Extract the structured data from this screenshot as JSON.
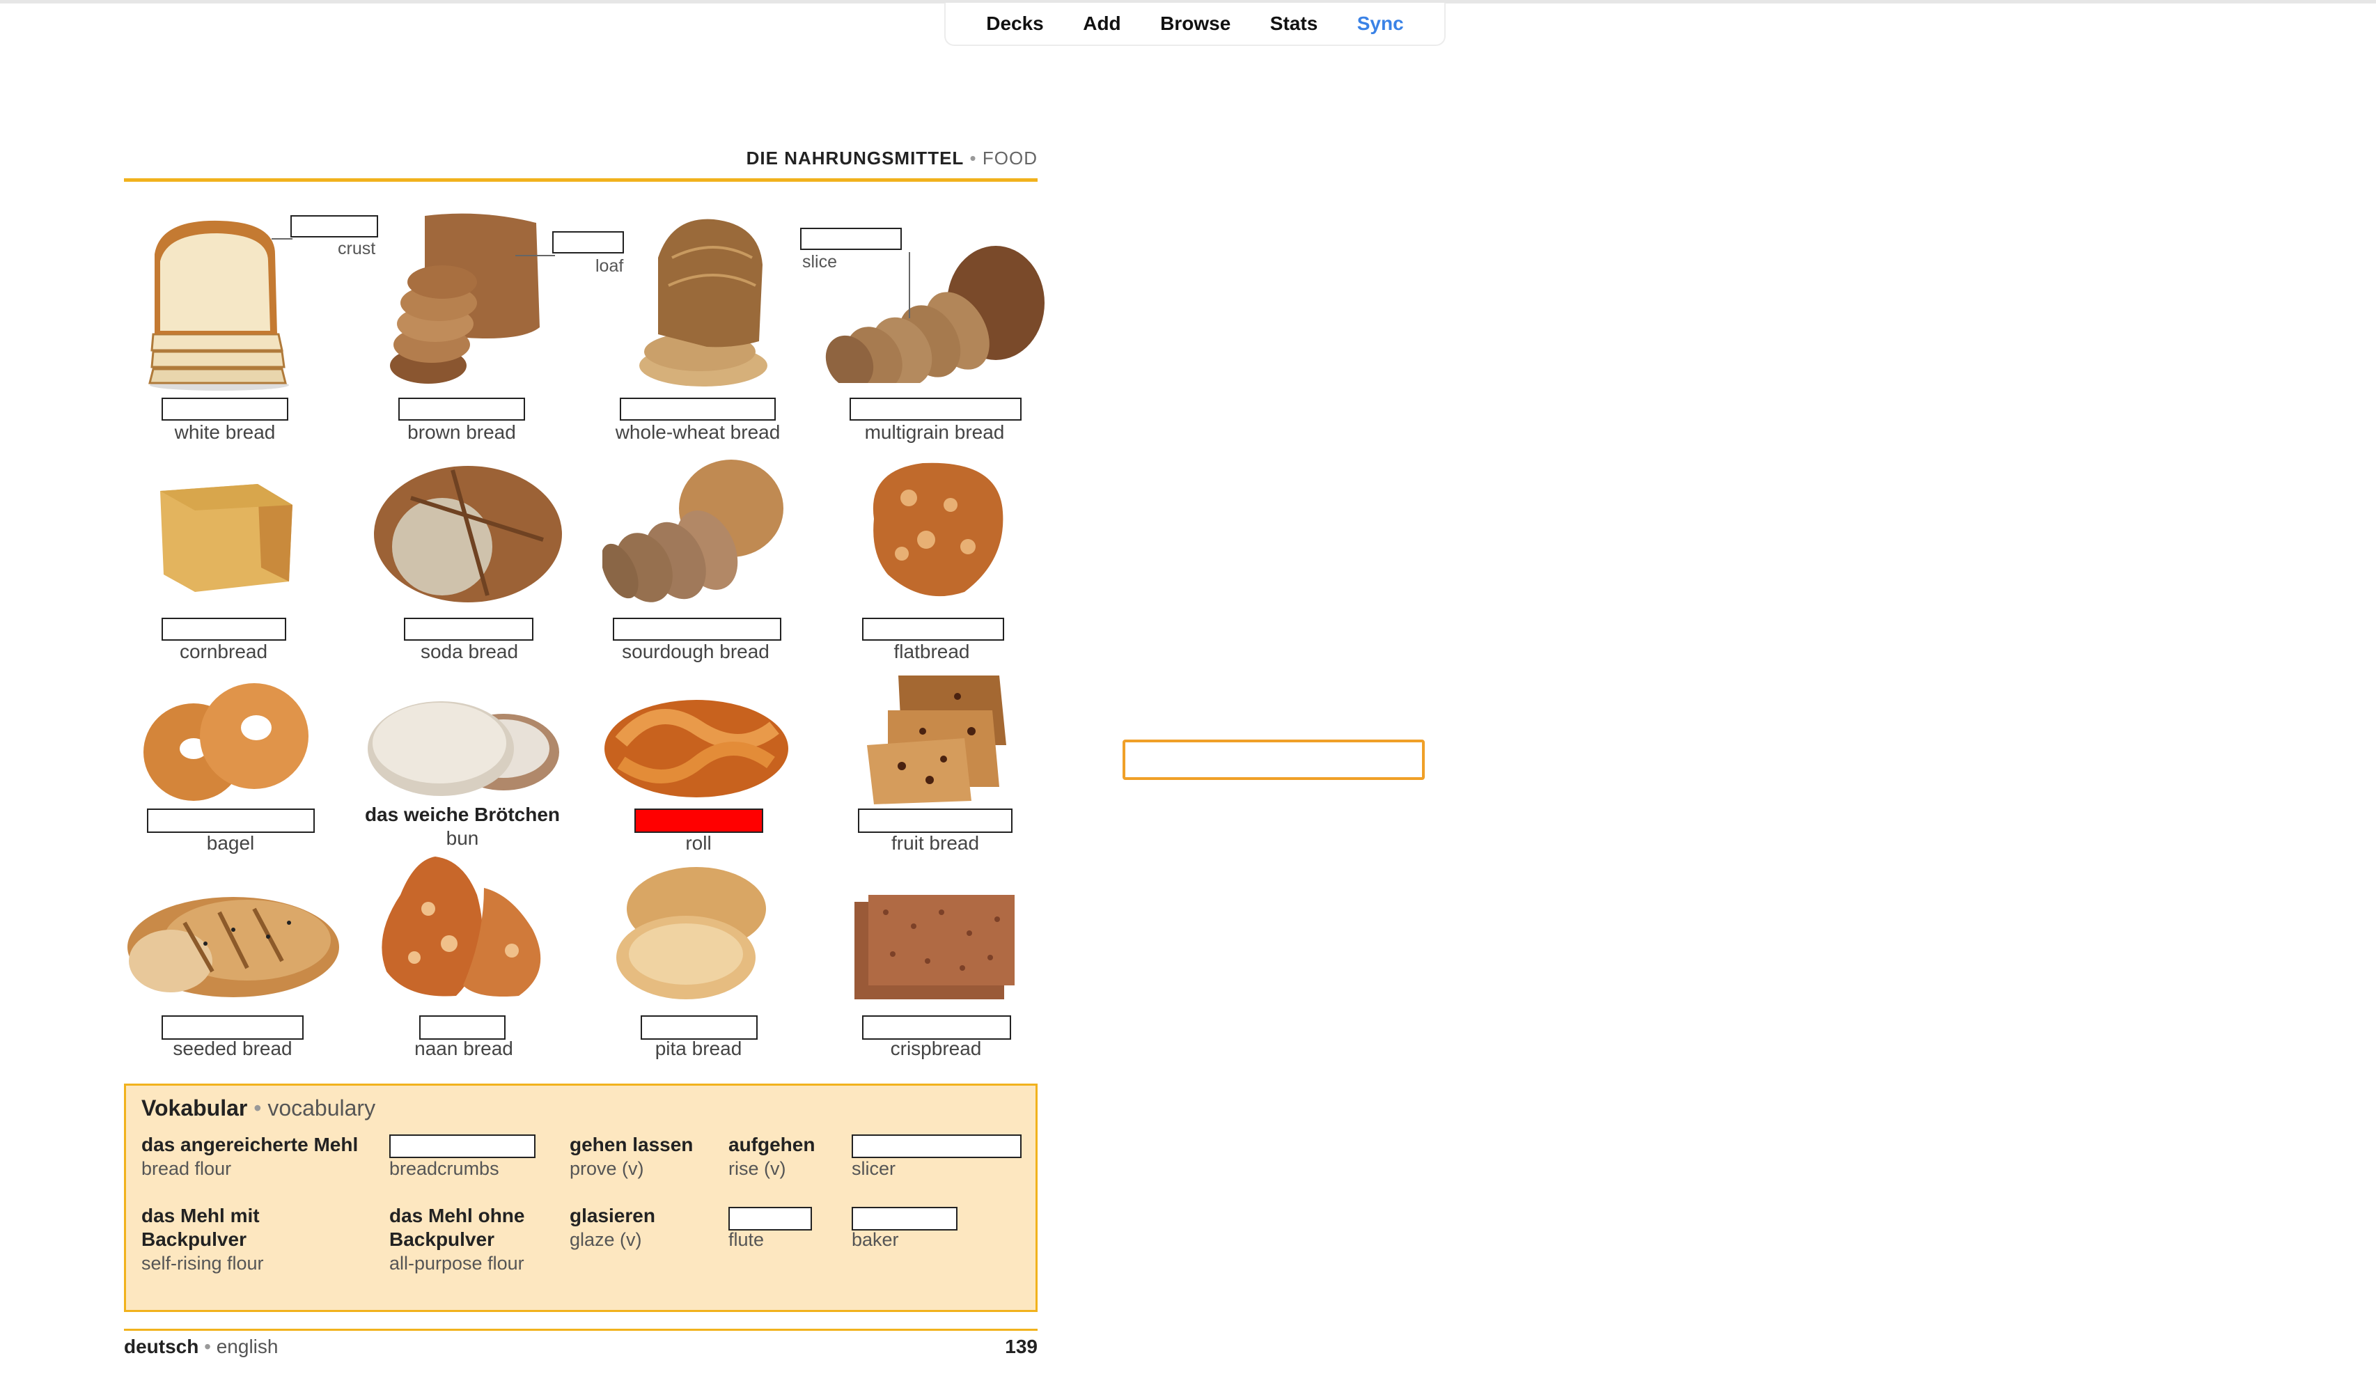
{
  "nav": {
    "decks": "Decks",
    "add": "Add",
    "browse": "Browse",
    "stats": "Stats",
    "sync": "Sync"
  },
  "header": {
    "german": "DIE NAHRUNGSMITTEL",
    "separator": "•",
    "english": "FOOD"
  },
  "labels": {
    "crust": "crust",
    "loaf": "loaf",
    "slice": "slice",
    "white_bread": "white bread",
    "brown_bread": "brown bread",
    "whole_wheat_bread": "whole-wheat bread",
    "multigrain_bread": "multigrain bread",
    "cornbread": "cornbread",
    "soda_bread": "soda bread",
    "sourdough_bread": "sourdough bread",
    "flatbread": "flatbread",
    "bagel": "bagel",
    "bun_de": "das weiche Brötchen",
    "bun": "bun",
    "roll": "roll",
    "fruit_bread": "fruit bread",
    "seeded_bread": "seeded bread",
    "naan_bread": "naan bread",
    "pita_bread": "pita bread",
    "crispbread": "crispbread"
  },
  "vocab": {
    "title_de": "Vokabular",
    "separator": "•",
    "title_en": "vocabulary",
    "bread_flour_de": "das angereicherte Mehl",
    "bread_flour_en": "bread flour",
    "breadcrumbs_en": "breadcrumbs",
    "prove_de": "gehen lassen",
    "prove_en": "prove (v)",
    "rise_de": "aufgehen",
    "rise_en": "rise (v)",
    "slicer_en": "slicer",
    "self_rising_de_1": "das Mehl mit",
    "self_rising_de_2": "Backpulver",
    "self_rising_en": "self-rising flour",
    "all_purpose_de_1": "das Mehl ohne",
    "all_purpose_de_2": "Backpulver",
    "all_purpose_en": "all-purpose flour",
    "glaze_de": "glasieren",
    "glaze_en": "glaze (v)",
    "flute_en": "flute",
    "baker_en": "baker"
  },
  "footer": {
    "lang_de": "deutsch",
    "separator": "•",
    "lang_en": "english",
    "page_number": "139"
  },
  "answer": {
    "value": ""
  },
  "colors": {
    "accent_yellow": "#f1b21d",
    "vocab_bg": "#fde7c0",
    "active_highlight": "#ff0000",
    "input_border": "#f0a028",
    "sync_blue": "#3a82e6"
  }
}
